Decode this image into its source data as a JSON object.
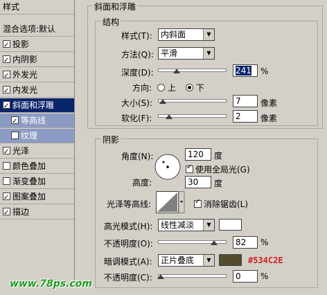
{
  "style_list": {
    "header": "样式",
    "items": [
      {
        "label": "混合选项:默认",
        "checkbox": false,
        "checked": false,
        "state": "normal"
      },
      {
        "label": "投影",
        "checkbox": true,
        "checked": true,
        "state": "normal"
      },
      {
        "label": "内阴影",
        "checkbox": true,
        "checked": true,
        "state": "normal"
      },
      {
        "label": "外发光",
        "checkbox": true,
        "checked": true,
        "state": "normal"
      },
      {
        "label": "内发光",
        "checkbox": true,
        "checked": true,
        "state": "normal"
      },
      {
        "label": "斜面和浮雕",
        "checkbox": true,
        "checked": true,
        "state": "selected"
      },
      {
        "label": "等高线",
        "checkbox": true,
        "checked": true,
        "state": "sub"
      },
      {
        "label": "纹理",
        "checkbox": true,
        "checked": false,
        "state": "sub"
      },
      {
        "label": "光泽",
        "checkbox": true,
        "checked": true,
        "state": "normal"
      },
      {
        "label": "颜色叠加",
        "checkbox": true,
        "checked": false,
        "state": "normal"
      },
      {
        "label": "渐变叠加",
        "checkbox": true,
        "checked": false,
        "state": "normal"
      },
      {
        "label": "图案叠加",
        "checkbox": true,
        "checked": true,
        "state": "normal"
      },
      {
        "label": "描边",
        "checkbox": true,
        "checked": true,
        "state": "normal"
      }
    ]
  },
  "bevel": {
    "title": "斜面和浮雕",
    "structure_title": "结构",
    "style_label": "样式(T):",
    "style_value": "内斜面",
    "technique_label": "方法(Q):",
    "technique_value": "平滑",
    "depth_label": "深度(D):",
    "depth_value": "241",
    "depth_unit": "%",
    "direction_label": "方向:",
    "direction_up": "上",
    "direction_down": "下",
    "size_label": "大小(S):",
    "size_value": "7",
    "size_unit": "像素",
    "soften_label": "软化(F):",
    "soften_value": "2",
    "soften_unit": "像素"
  },
  "shading": {
    "title": "阴影",
    "angle_label": "角度(N):",
    "angle_value": "120",
    "angle_unit": "度",
    "global_light_label": "使用全局光(G)",
    "altitude_label": "高度:",
    "altitude_value": "30",
    "altitude_unit": "度",
    "gloss_contour_label": "光泽等高线:",
    "anti_aliased_label": "消除锯齿(L)",
    "highlight_mode_label": "高光模式(H):",
    "highlight_mode_value": "线性减淡",
    "highlight_color": "#ffffff",
    "highlight_opacity_label": "不透明度(O):",
    "highlight_opacity_value": "82",
    "highlight_opacity_unit": "%",
    "shadow_mode_label": "暗调模式(A):",
    "shadow_mode_value": "正片叠底",
    "shadow_color": "#534C2E",
    "shadow_color_label": "#534C2E",
    "shadow_opacity_label": "不透明度(C):",
    "shadow_opacity_value": "0",
    "shadow_opacity_unit": "%"
  },
  "watermark": "www.78ps.com"
}
